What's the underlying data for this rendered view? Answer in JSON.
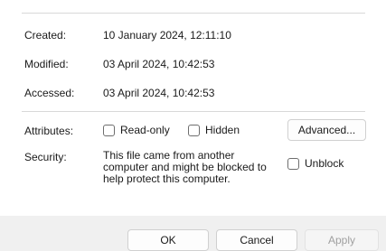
{
  "dates": {
    "created_label": "Created:",
    "created_value": "10 January 2024, 12:11:10",
    "modified_label": "Modified:",
    "modified_value": "03 April 2024, 10:42:53",
    "accessed_label": "Accessed:",
    "accessed_value": "03 April 2024, 10:42:53"
  },
  "attributes": {
    "label": "Attributes:",
    "readonly_label": "Read-only",
    "readonly_checked": false,
    "hidden_label": "Hidden",
    "hidden_checked": false,
    "advanced_label": "Advanced..."
  },
  "security": {
    "label": "Security:",
    "message": "This file came from another\ncomputer and might be blocked to\nhelp protect this computer.",
    "unblock_label": "Unblock",
    "unblock_checked": false
  },
  "footer": {
    "ok_label": "OK",
    "cancel_label": "Cancel",
    "apply_label": "Apply",
    "apply_enabled": false
  }
}
